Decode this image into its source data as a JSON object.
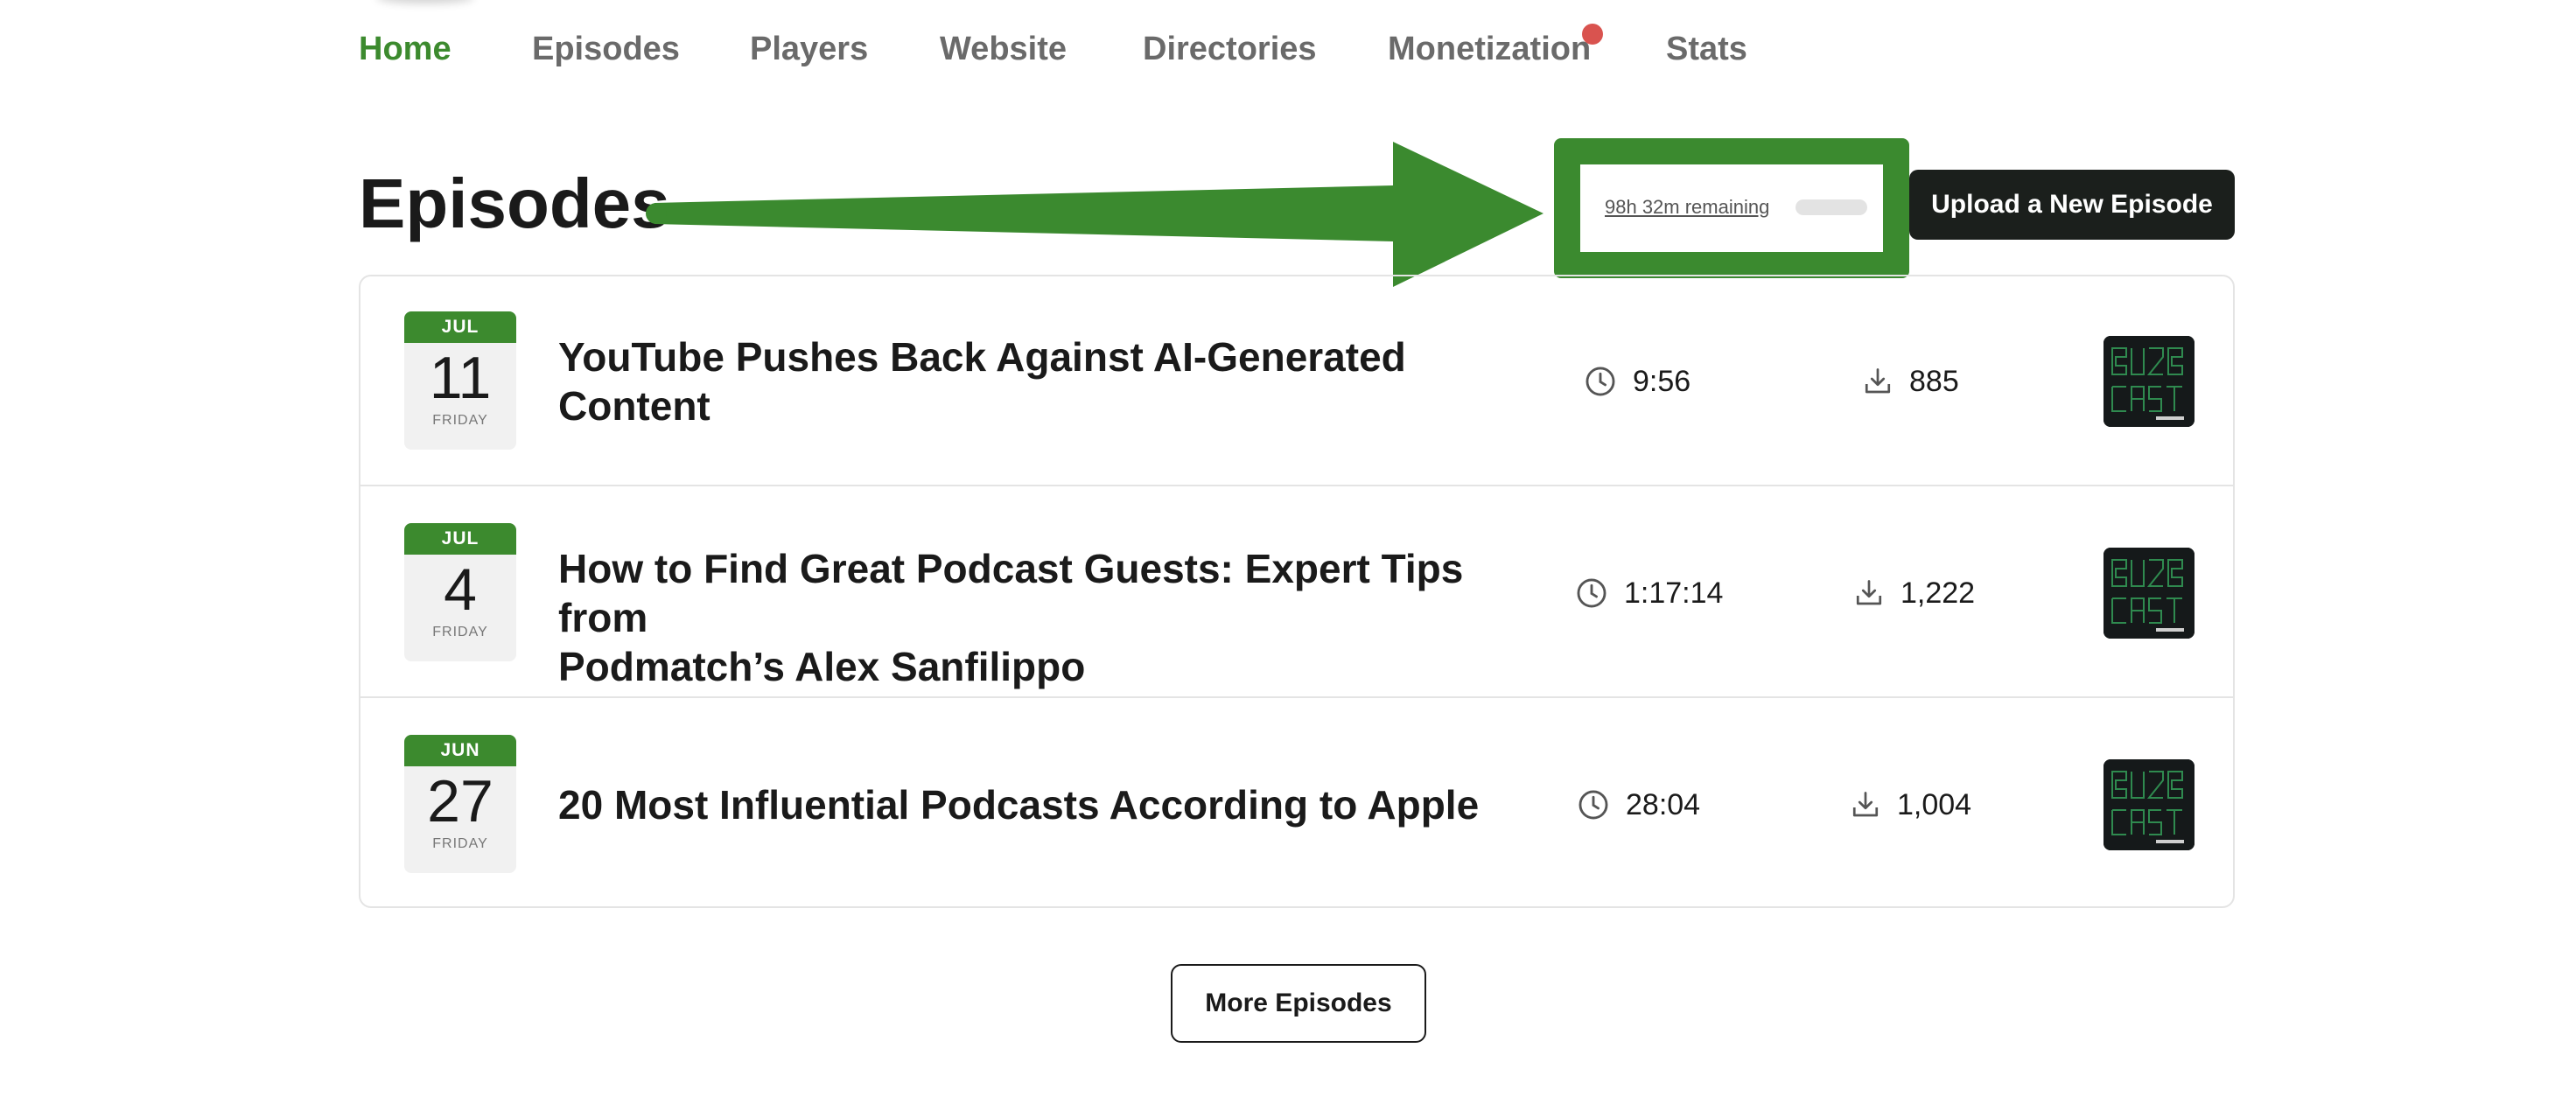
{
  "nav": {
    "items": [
      {
        "label": "Home",
        "active": true
      },
      {
        "label": "Episodes",
        "active": false
      },
      {
        "label": "Players",
        "active": false
      },
      {
        "label": "Website",
        "active": false
      },
      {
        "label": "Directories",
        "active": false
      },
      {
        "label": "Monetization",
        "active": false,
        "notification_dot": true
      },
      {
        "label": "Stats",
        "active": false
      }
    ]
  },
  "page": {
    "title": "Episodes"
  },
  "storage": {
    "remaining_label": "98h 32m remaining",
    "used_fraction": 0.0
  },
  "upload_button": {
    "label": "Upload a New Episode"
  },
  "episodes": [
    {
      "month": "JUL",
      "day": "11",
      "weekday": "FRIDAY",
      "title_line1": "YouTube Pushes Back Against AI-Generated",
      "title_line2": "Content",
      "duration": "9:56",
      "downloads": "885"
    },
    {
      "month": "JUL",
      "day": "4",
      "weekday": "FRIDAY",
      "title_line1": "How to Find Great Podcast Guests: Expert Tips from",
      "title_line2": "Podmatch’s Alex Sanfilippo",
      "duration": "1:17:14",
      "downloads": "1,222"
    },
    {
      "month": "JUN",
      "day": "27",
      "weekday": "FRIDAY",
      "title_line1": "20 Most Influential Podcasts According to Apple",
      "title_line2": "",
      "duration": "28:04",
      "downloads": "1,004"
    }
  ],
  "more_button": {
    "label": "More Episodes"
  },
  "colors": {
    "accent_green": "#3c8a2e",
    "annotation_green": "#3b8a2f",
    "notification_red": "#d9534f",
    "button_dark": "#1b1f1c"
  },
  "icons": {
    "duration": "clock-icon",
    "downloads": "download-icon",
    "artwork": "podcast-artwork"
  }
}
